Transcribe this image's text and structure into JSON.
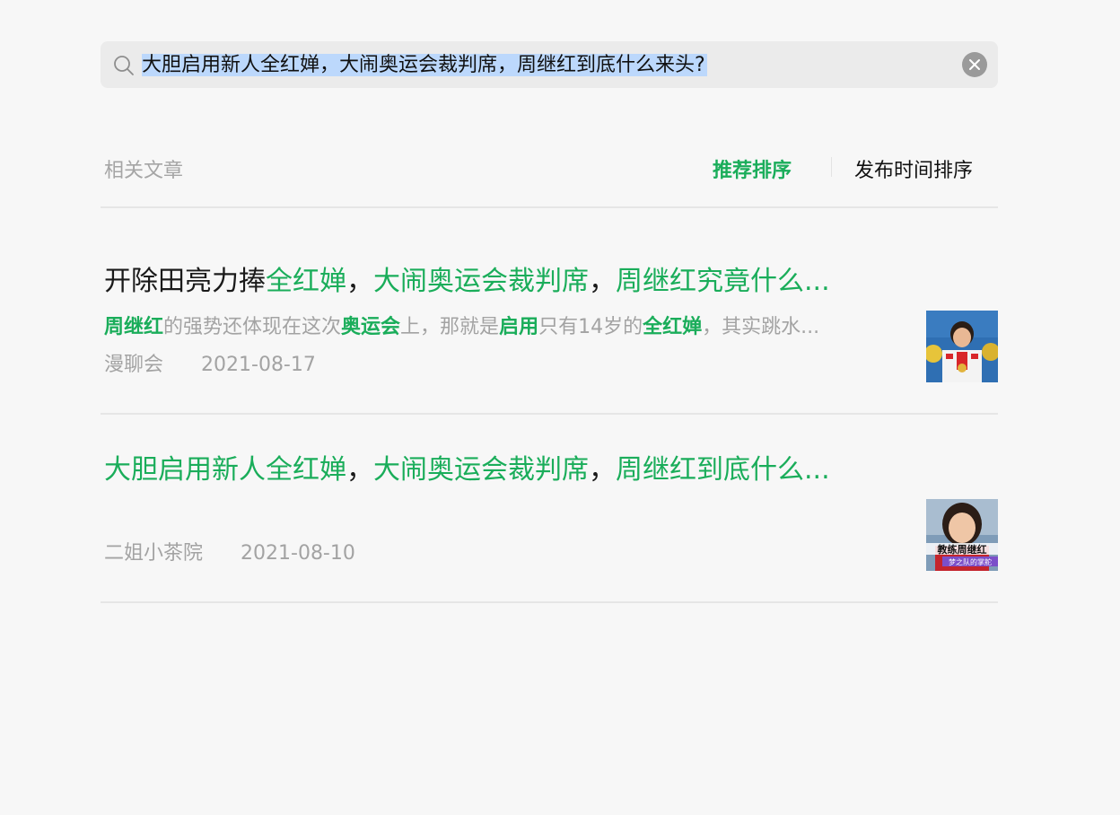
{
  "search": {
    "query": "大胆启用新人全红婵，大闹奥运会裁判席，周继红到底什么来头?"
  },
  "section": {
    "label": "相关文章",
    "sort_recommend": "推荐排序",
    "sort_time": "发布时间排序"
  },
  "results": [
    {
      "title_parts": [
        "开除田亮力捧",
        "全红婵",
        "，",
        "大闹奥运会裁判席",
        "，",
        "周继红究竟什么..."
      ],
      "snippet_parts": [
        "周继红",
        "的强势还体现在这次",
        "奥运会",
        "上，那就是",
        "启用",
        "只有14岁的",
        "全红婵",
        "，其实跳水..."
      ],
      "source": "漫聊会",
      "date": "2021-08-17",
      "thumbnail_icon": "diver-medal-photo"
    },
    {
      "title_parts": [
        "大胆启用新人全红婵",
        "，",
        "大闹奥运会裁判席",
        "，",
        "周继红到底什么..."
      ],
      "source": "二姐小茶院",
      "date": "2021-08-10",
      "thumbnail_icon": "coach-portrait-photo",
      "thumbnail_caption": "教练周继红",
      "thumbnail_subcaption": "梦之队的掌舵"
    }
  ],
  "colors": {
    "accent": "#1aad5a",
    "selection": "#bcd8fc",
    "muted": "#a3a3a3",
    "background": "#f7f7f7"
  }
}
